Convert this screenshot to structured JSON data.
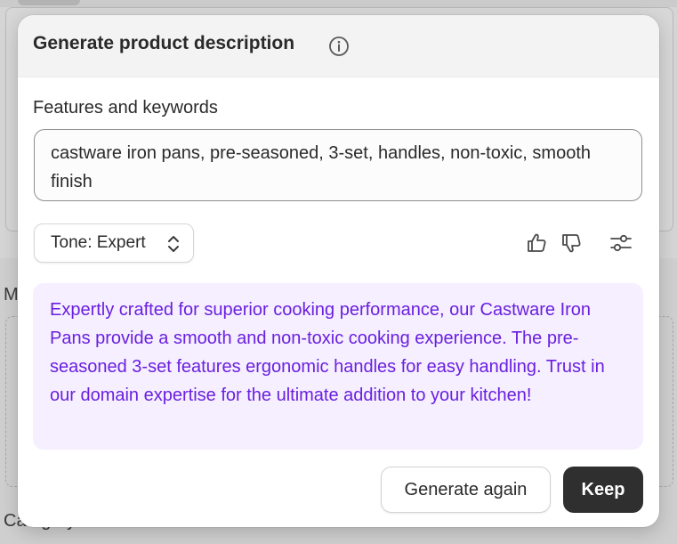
{
  "background": {
    "partial_label_top": "M",
    "partial_label_bottom": "Category"
  },
  "modal": {
    "title": "Generate product description",
    "title_icon": "info-icon",
    "features_label": "Features and keywords",
    "features_value": "castware iron pans, pre-seasoned, 3-set, handles, non-toxic, smooth finish",
    "tone": {
      "label": "Tone: Expert",
      "icon": "chevron-up-down-icon"
    },
    "feedback_icons": [
      "thumbs-up-icon",
      "thumbs-down-icon",
      "sliders-icon"
    ],
    "generated_text": "Expertly crafted for superior cooking performance, our Castware Iron Pans provide a smooth and non-toxic cooking experience. The pre-seasoned 3-set features ergonomic handles for easy handling. Trust in our domain expertise for the ultimate addition to your kitchen!",
    "buttons": {
      "generate_again": "Generate again",
      "keep": "Keep"
    }
  },
  "colors": {
    "accent_text": "#6a1fe0",
    "accent_bg": "#f5efff",
    "primary_button": "#2f2f2f"
  }
}
